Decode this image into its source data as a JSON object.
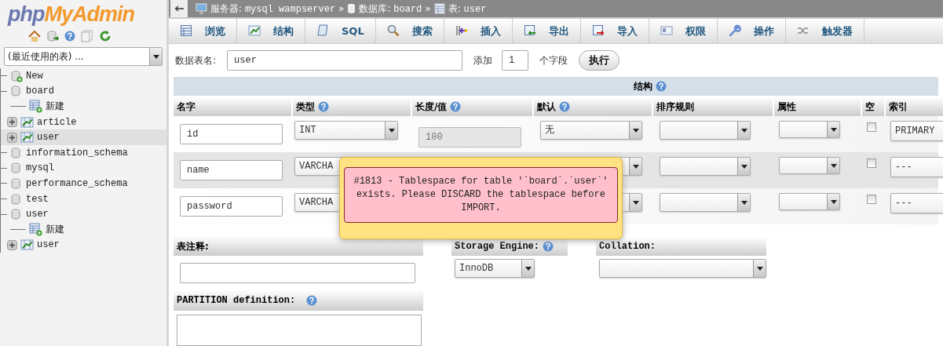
{
  "logo": {
    "php": "php",
    "name": "MyAdmin"
  },
  "sidebar": {
    "recent_tables": "(最近使用的表) ...",
    "tree": [
      {
        "label": "New",
        "kind": "new",
        "selected": false
      },
      {
        "label": "board",
        "kind": "database",
        "selected": false,
        "children": [
          {
            "label": "新建",
            "kind": "new_table",
            "selected": false
          },
          {
            "label": "article",
            "kind": "table",
            "selected": false
          },
          {
            "label": "user",
            "kind": "table",
            "selected": true
          }
        ]
      },
      {
        "label": "information_schema",
        "kind": "database",
        "selected": false
      },
      {
        "label": "mysql",
        "kind": "database",
        "selected": false
      },
      {
        "label": "performance_schema",
        "kind": "database",
        "selected": false
      },
      {
        "label": "test",
        "kind": "database",
        "selected": false
      },
      {
        "label": "user",
        "kind": "database",
        "selected": false,
        "children": [
          {
            "label": "新建",
            "kind": "new_table",
            "selected": false
          },
          {
            "label": "user",
            "kind": "table",
            "selected": false
          }
        ]
      }
    ]
  },
  "breadcrumb": {
    "separator": "»",
    "items": [
      {
        "kind": "server",
        "label": "服务器:",
        "value": "mysql wampserver"
      },
      {
        "kind": "database",
        "label": "数据库:",
        "value": "board"
      },
      {
        "kind": "table",
        "label": "表:",
        "value": "user"
      }
    ]
  },
  "tabs": [
    {
      "label": "浏览",
      "kind": "browse",
      "selected": false
    },
    {
      "label": "结构",
      "kind": "structure",
      "selected": false
    },
    {
      "label": "SQL",
      "kind": "sql",
      "selected": false
    },
    {
      "label": "搜索",
      "kind": "search",
      "selected": false
    },
    {
      "label": "插入",
      "kind": "insert",
      "selected": false
    },
    {
      "label": "导出",
      "kind": "export",
      "selected": false
    },
    {
      "label": "导入",
      "kind": "import",
      "selected": false
    },
    {
      "label": "权限",
      "kind": "privileges",
      "selected": false
    },
    {
      "label": "操作",
      "kind": "operations",
      "selected": false
    },
    {
      "label": "触发器",
      "kind": "triggers",
      "selected": false
    }
  ],
  "form": {
    "table_name_label": "数据表名:",
    "table_name": "user",
    "add_label": "添加",
    "add_count": "1",
    "add_suffix": "个字段",
    "go_button": "执行"
  },
  "structure": {
    "title": "结构",
    "columns": [
      {
        "label": "名字",
        "help": false
      },
      {
        "label": "类型",
        "help": true
      },
      {
        "label": "长度/值",
        "help": true
      },
      {
        "label": "默认",
        "help": true
      },
      {
        "label": "排序规则",
        "help": false
      },
      {
        "label": "属性",
        "help": false
      },
      {
        "label": "空",
        "help": false
      },
      {
        "label": "索引",
        "help": false
      }
    ],
    "rows": [
      {
        "kind": "full",
        "name": "id",
        "type": "INT",
        "length": "100",
        "length_disabled": true,
        "default": "无",
        "null_checked": false,
        "index": "PRIMARY"
      },
      {
        "kind": "covered",
        "name": "name",
        "type": "VARCHA",
        "null_checked": false,
        "index": "---"
      },
      {
        "kind": "covered",
        "name": "password",
        "type": "VARCHA",
        "null_checked": false,
        "index": "---"
      }
    ]
  },
  "options": {
    "comment_label": "表注释:",
    "storage_engine_label": "Storage Engine:",
    "storage_engine": "InnoDB",
    "collation_label": "Collation:",
    "partition_label": "PARTITION definition:"
  },
  "error": {
    "message": "#1813 - Tablespace for table '`board`.`user`' exists. Please DISCARD the tablespace before IMPORT."
  }
}
